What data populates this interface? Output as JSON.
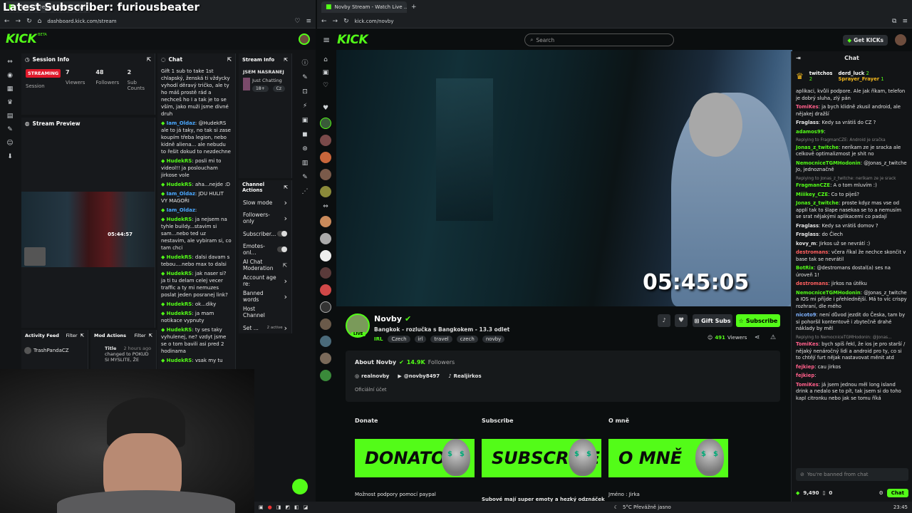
{
  "overlay_title": "Latest Subscriber: furiousbeater",
  "left_browser": {
    "tab_title": "Novby Stream - Watch Live ...",
    "url": "dashboard.kick.com/stream"
  },
  "right_browser": {
    "tab_title": "Novby Stream - Watch Live ...",
    "url": "kick.com/novby"
  },
  "brand": {
    "logo": "KICK",
    "beta": "BETA",
    "accent": "#53fc18"
  },
  "session_info": {
    "title": "Session Info",
    "status": "STREAMING",
    "status_label": "Session",
    "viewers": "7",
    "viewers_label": "Viewers",
    "followers": "48",
    "followers_label": "Followers",
    "subs": "2",
    "subs_label": "Sub Counts"
  },
  "stream_preview": {
    "title": "Stream Preview",
    "timer": "05:44:57"
  },
  "activity": {
    "title": "Activity Feed",
    "filter": "Filter",
    "user": "TrashPandaCZ",
    "mod_title": "Mod Actions",
    "mod_filter": "Filter",
    "mod_field": "Title",
    "mod_time": "2 hours ago",
    "mod_text": "changed to POKUD SI MYSLITE, ŽE"
  },
  "dash_chat": {
    "title": "Chat",
    "messages": [
      {
        "user": "",
        "text": "Gift 1 sub to take 1st chlapský, ženská ti vždycky vyhodí děravý tričko, ale ty ho máš prostě rád a nechceš ho I a tak je to se vším, jako muži jsme divné druh"
      },
      {
        "user": "Iam_Oldaz",
        "text": "@HudekRS ale to já taky, no tak si zase koupím třeba legion, nebo kidně aliena... ale nebudu to řešit dokud to nezdechne"
      },
      {
        "user": "HudekRS",
        "text": "posli mi to videol!! ja posloucham jirkose vole"
      },
      {
        "user": "HudekRS",
        "text": "aha...nejde :D"
      },
      {
        "user": "Iam_Oldaz",
        "text": "JDU HULIT VY MAGOŘI"
      },
      {
        "user": "Iam_Oldaz",
        "text": ""
      },
      {
        "user": "HudekRS",
        "text": "ja nejsem na tyhle buildy...stavim si sam...nebo ted uz nestavim, ale vybiram si, co tam chci"
      },
      {
        "user": "HudekRS",
        "text": "dalsi davam s tebou....nebo max to dalsi"
      },
      {
        "user": "HudekRS",
        "text": "jak naser si? ja ti tu delam celej vecer traffic a ty mi nemuzes poslat jeden posranej link?"
      },
      {
        "user": "HudekRS",
        "text": "ok...diky"
      },
      {
        "user": "HudekRS",
        "text": "ja mam notikace vypnuty"
      },
      {
        "user": "HudekRS",
        "text": "ty ses taky vyhulenej, ne? vzdyt jsme se o tom bavili asi pred 2 hodinama"
      },
      {
        "user": "HudekRS",
        "text": "vsak my tu"
      }
    ]
  },
  "stream_info": {
    "title": "Stream Info",
    "stream_title": "JSEM NASRANEJ",
    "category": "Just Chatting",
    "age": "18+",
    "lang": "Cz"
  },
  "channel_actions": {
    "title": "Channel Actions",
    "items": [
      {
        "label": "Slow mode",
        "control": "chevron"
      },
      {
        "label": "Followers-only",
        "control": "chevron"
      },
      {
        "label": "Subscriber...",
        "control": "toggle"
      },
      {
        "label": "Emotes-onl...",
        "control": "toggle"
      },
      {
        "label": "AI Chat Moderation",
        "control": "external"
      },
      {
        "label": "Account age re:",
        "control": "chevron"
      },
      {
        "label": "Banned words",
        "control": "chevron"
      },
      {
        "label": "Host Channel",
        "control": "none"
      },
      {
        "label": "Set ...",
        "control": "chevron",
        "extra": "2 active"
      }
    ]
  },
  "kick": {
    "search_placeholder": "Search",
    "get_kicks": "Get KICKs",
    "timer": "05:45:05",
    "channel_name": "Novby",
    "stream_title": "Bangkok - rozlučka s Bangkokem - 13.3 odlet",
    "category": "IRL",
    "tags": [
      "Czech",
      "irl",
      "travel",
      "czech",
      "novby"
    ],
    "gift_subs": "Gift Subs",
    "subscribe": "Subscribe",
    "viewers": "491",
    "viewers_label": "Viewers",
    "live_badge": "LIVE",
    "about_title": "About Novby",
    "followers": "14.9K",
    "followers_label": "Followers",
    "socials": [
      "realnovby",
      "@novby8497",
      "Realjirkos"
    ],
    "official": "Oficiální účet",
    "panels": [
      {
        "heading": "Donate",
        "banner": "DONATOSS",
        "caption": "Možnost podpory pomocí paypal"
      },
      {
        "heading": "Subscribe",
        "banner": "SUBSCRIBE",
        "caption": "Subové mají super emoty a hezký odznáček"
      },
      {
        "heading": "O mně",
        "banner": "O MNĚ",
        "caption": "Jméno : Jirka"
      }
    ]
  },
  "right_chat": {
    "title": "Chat",
    "gifters": [
      {
        "name": "twitchos",
        "count": "2"
      },
      {
        "name": "derd_luck",
        "count": "2"
      },
      {
        "name": "Sprayer_Frayer",
        "count": "1"
      }
    ],
    "messages": [
      {
        "user": "",
        "color": "#e6e6e6",
        "text": "aplikaci, kvůli podpore. Ale jak říkam, telefon je dobrý sluha, zlý pán"
      },
      {
        "user": "TomiKes",
        "color": "#ff5f8a",
        "text": "ja bych klidně zkusil android, ale nějakej dražší"
      },
      {
        "user": "Fraglass",
        "color": "#e6e6e6",
        "text": "Kedy sa vrátiš do CZ ?"
      },
      {
        "user": "adamos99",
        "color": "#53fc18",
        "text": ""
      },
      {
        "user": "Jonas_z_twitche",
        "color": "#53fc18",
        "text": "neríkam ze je sracka ale celkově optimalizmost je shit no",
        "reply": "Replying to FragmanCZE: Android je sračka"
      },
      {
        "user": "NemocniceTGMHodonin",
        "color": "#53fc18",
        "text": "@Jonas_z_twitche Jo, jednoznačně"
      },
      {
        "user": "FragmanCZE",
        "color": "#53fc18",
        "text": "A o tom mluvím :)",
        "reply": "Replying to Jonas_z_twitche: neríkam ze je srack"
      },
      {
        "user": "Miiikey_CZE",
        "color": "#53fc18",
        "text": "Co to piješ?"
      },
      {
        "user": "Jonas_z_twitche",
        "color": "#53fc18",
        "text": "proste kdyz mas vse od applí tak to šlape nasekaa se to a nemusím se srat nějakými aplikacemi co padají"
      },
      {
        "user": "Fraglass",
        "color": "#e6e6e6",
        "text": "Kedy sa vrátiš domov ?"
      },
      {
        "user": "Fraglass",
        "color": "#e6e6e6",
        "text": "do Čiech"
      },
      {
        "user": "kovy_m",
        "color": "#e6e6e6",
        "text": "Jirkos už se nevrátí :)"
      },
      {
        "user": "destromans",
        "color": "#ff5f5f",
        "text": "včera říkal že nechce skončit v base tak se nevrátil"
      },
      {
        "user": "BotRix",
        "color": "#53fc18",
        "text": "@destromans dostal(a) ses na úroveň 1!"
      },
      {
        "user": "destromans",
        "color": "#ff5f5f",
        "text": "jirkos na útěku"
      },
      {
        "user": "NemocniceTGMHodonin",
        "color": "#53fc18",
        "text": "@Jonas_z_twitche a IOS mi příjde i přehlednější. Má to víc crispy rozhraní, dle mého"
      },
      {
        "user": "nicoto9",
        "color": "#7fb3ff",
        "text": "není důvod jezdit do Česka, tam by si pohoršil kontentově i zbytečně drahé náklady by měl"
      },
      {
        "user": "TomiKes",
        "color": "#ff5f8a",
        "text": "bych spíš řekl, že ios je pro starší / nějaký nenáročný lidi a android pro ty, co si to chtějí furt nějak nastavovat měnit atd",
        "reply": "Replying to NemocniceTGMHodonin: @Jonas..."
      },
      {
        "user": "fejkiep",
        "color": "#ff5f8a",
        "text": "cau jirkos"
      },
      {
        "user": "fejkiep",
        "color": "#ff5f8a",
        "text": ""
      },
      {
        "user": "TomiKes",
        "color": "#ff5f8a",
        "text": "já jsem jednou měl long island drink a nedalo se to pít, tak jsem si do toho kapl citronku nebo jak se tomu říká"
      }
    ],
    "banned_placeholder": "You're banned from chat",
    "points": "9,490",
    "zero": "0",
    "chat_btn": "Chat"
  },
  "taskbar": {
    "weather": "5°C  Převážně jasno",
    "time": "23:45"
  }
}
